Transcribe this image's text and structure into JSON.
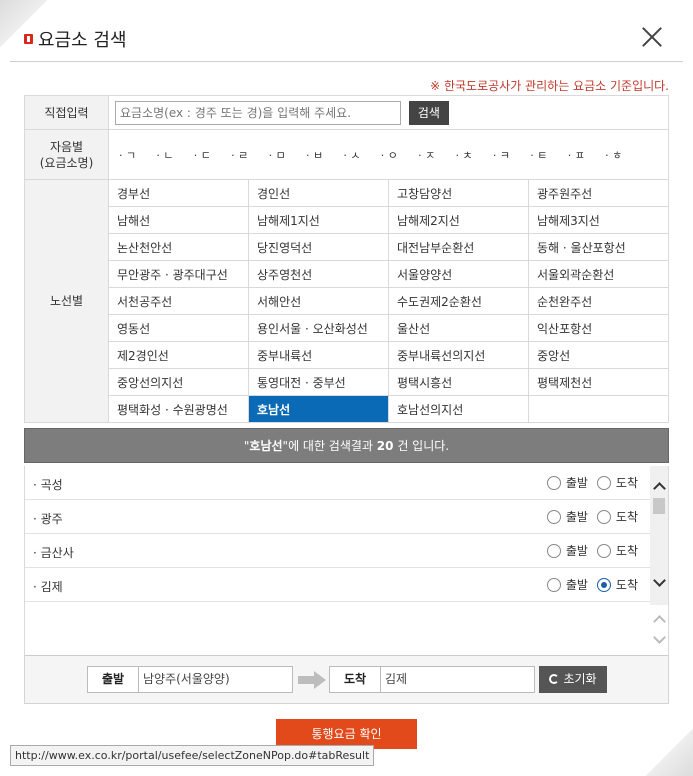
{
  "header": {
    "title": "요금소 검색"
  },
  "notice": "※ 한국도로공사가 관리하는 요금소 기준입니다.",
  "direct": {
    "label": "직접입력",
    "placeholder": "요금소명(ex : 경주 또는 경)을 입력해 주세요.",
    "button": "검색"
  },
  "consonant": {
    "label_line1": "자음별",
    "label_line2": "(요금소명)",
    "items": [
      "ㄱ",
      "ㄴ",
      "ㄷ",
      "ㄹ",
      "ㅁ",
      "ㅂ",
      "ㅅ",
      "ㅇ",
      "ㅈ",
      "ㅊ",
      "ㅋ",
      "ㅌ",
      "ㅍ",
      "ㅎ"
    ]
  },
  "routes": {
    "label": "노선별",
    "rows": [
      [
        "경부선",
        "경인선",
        "고창담양선",
        "광주원주선"
      ],
      [
        "남해선",
        "남해제1지선",
        "남해제2지선",
        "남해제3지선"
      ],
      [
        "논산천안선",
        "당진영덕선",
        "대전남부순환선",
        "동해 · 울산포항선"
      ],
      [
        "무안광주 · 광주대구선",
        "상주영천선",
        "서울양양선",
        "서울외곽순환선"
      ],
      [
        "서천공주선",
        "서해안선",
        "수도권제2순환선",
        "순천완주선"
      ],
      [
        "영동선",
        "용인서울 · 오산화성선",
        "울산선",
        "익산포항선"
      ],
      [
        "제2경인선",
        "중부내륙선",
        "중부내륙선의지선",
        "중앙선"
      ],
      [
        "중앙선의지선",
        "통영대전 · 중부선",
        "평택시흥선",
        "평택제천선"
      ],
      [
        "평택화성 · 수원광명선",
        "호남선",
        "호남선의지선",
        ""
      ]
    ],
    "active": "호남선"
  },
  "result": {
    "quote_open": "\"",
    "keyword": "호남선",
    "quote_close": "\"",
    "mid": "에 대한 검색결과 ",
    "count": "20",
    "tail": " 건 입니다."
  },
  "radio_labels": {
    "depart": "출발",
    "arrive": "도착"
  },
  "results": [
    {
      "name": "곡성",
      "selected": ""
    },
    {
      "name": "광주",
      "selected": ""
    },
    {
      "name": "금산사",
      "selected": ""
    },
    {
      "name": "김제",
      "selected": "arrive"
    }
  ],
  "summary": {
    "depart_label": "출발",
    "depart_value": "남양주(서울양양)",
    "arrive_label": "도착",
    "arrive_value": "김제",
    "reset_label": "초기화"
  },
  "confirm_label": "통행요금 확인",
  "status_url": "http://www.ex.co.kr/portal/usefee/selectZoneNPop.do#tabResult",
  "colors": {
    "accent_red": "#e34a1b",
    "active_blue": "#0b6ab5",
    "result_bar": "#7d7d7d"
  }
}
